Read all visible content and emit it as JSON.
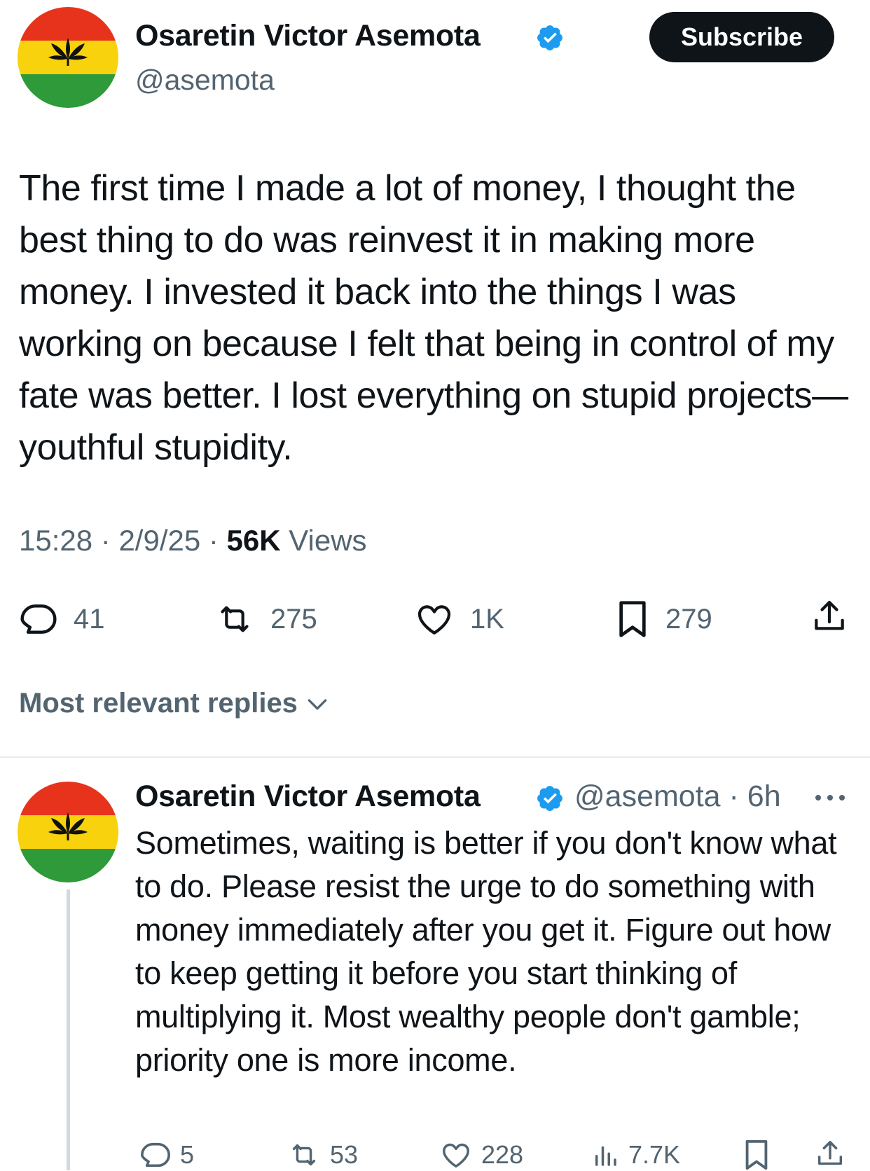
{
  "tweet": {
    "author_name": "Osaretin Victor Asemota",
    "handle": "@asemota",
    "subscribe_label": "Subscribe",
    "text": "The first time I made a lot of money, I thought the best thing to do was reinvest it in making more money. I invested it back into the things I was working on because I felt that being in control of my fate was better. I lost everything on stupid projects—youthful stupidity.",
    "time": "15:28",
    "date": "2/9/25",
    "sep": " · ",
    "views_count": "56K",
    "views_label": "Views",
    "replies": "41",
    "reposts": "275",
    "likes": "1K",
    "bookmarks": "279"
  },
  "replies_section": {
    "sort_label": "Most relevant replies"
  },
  "reply": {
    "author_name": "Osaretin Victor Asemota",
    "handle": "@asemota",
    "time_ago": "6h",
    "sep": " · ",
    "text": "Sometimes, waiting is better if you don't know what to do. Please resist the urge to do something with money immediately after you get it. Figure out how to keep getting it before you start thinking of multiplying it. Most wealthy people don't gamble; priority one is more income.",
    "replies": "5",
    "reposts": "53",
    "likes": "228",
    "views": "7.7K"
  },
  "icons": {
    "avatar": "flag-leaf-avatar",
    "verified": "verified-badge-icon",
    "reply": "reply-icon",
    "repost": "repost-icon",
    "like": "heart-icon",
    "bookmark": "bookmark-icon",
    "share": "share-icon",
    "views": "views-icon",
    "chevron": "chevron-down-icon",
    "more": "more-icon"
  },
  "colors": {
    "verified_blue": "#1d9bf0",
    "text_primary": "#0f1419",
    "text_secondary": "#536471",
    "flag_red": "#e8331c",
    "flag_yellow": "#f8d20c",
    "flag_green": "#2e9a39"
  }
}
